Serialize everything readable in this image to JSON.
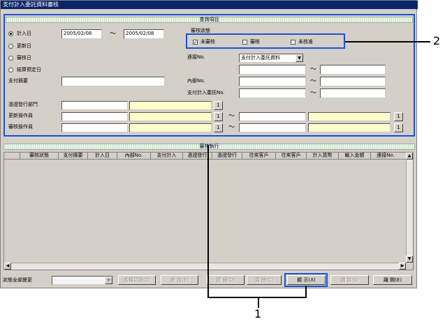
{
  "window": {
    "title": "支付計入委託資料審核"
  },
  "search": {
    "section_title": "查詢項目",
    "radio_options": [
      "計入日",
      "更新日",
      "審核日",
      "結算預定日"
    ],
    "date_from": "2005/02/08",
    "date_to": "2005/02/08",
    "tilde": "〜",
    "status_label": "審核狀態",
    "status_options": [
      {
        "label": "未審核",
        "checked": "✓"
      },
      {
        "label": "審核",
        "checked": ""
      },
      {
        "label": "未核准",
        "checked": ""
      }
    ],
    "link_no_label": "連接No.",
    "link_no_value": "支付計入委託資料",
    "internal_no_label": "內部No.",
    "payment_no_label": "支付計入委託No.",
    "summary_label": "支付摘要",
    "voucher_dept_label": "憑證發行部門",
    "updater_label": "更新操作員",
    "reviewer_label": "審核操作員",
    "lookup_btn": "1"
  },
  "results": {
    "section_title": "審核執行",
    "columns": [
      "審核狀態",
      "支付摘要",
      "計入日",
      "內部No.",
      "支付計入",
      "憑證發行",
      "憑證發行",
      "往來客戶",
      "往來客戶",
      "計入貨幣",
      "輸入金額",
      "連接No."
    ]
  },
  "footer": {
    "bulk_change_label": "狀態全部變更",
    "buttons": [
      {
        "label": "名稱切換(Z)",
        "disabled": true
      },
      {
        "label": "修 改(E)",
        "disabled": true
      },
      {
        "label": "詳 細(D)",
        "disabled": true
      },
      {
        "label": "清 除(C)",
        "disabled": true
      },
      {
        "label": "顯 示(X)",
        "disabled": false
      },
      {
        "label": "儲 存(S)",
        "disabled": true
      },
      {
        "label": "離 開(E)",
        "disabled": false
      }
    ]
  },
  "annotations": {
    "callout_1": "1",
    "callout_2": "2"
  }
}
